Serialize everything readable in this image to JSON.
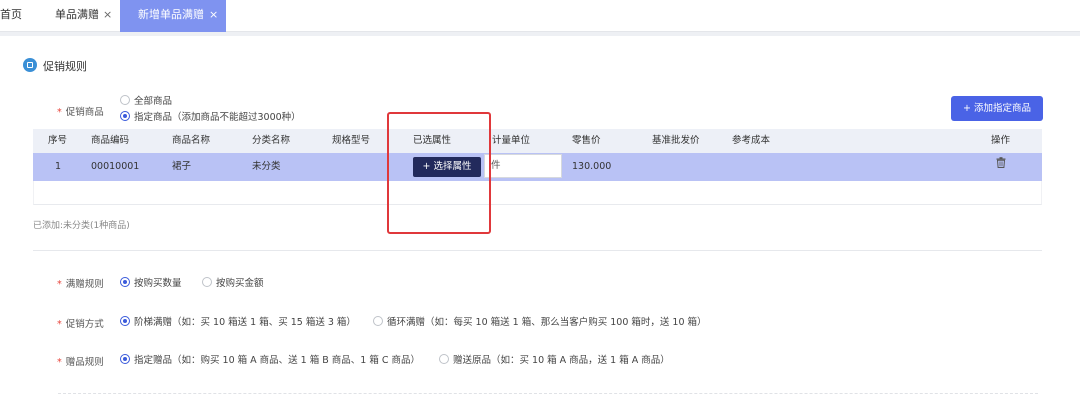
{
  "tabs": {
    "home": "首页",
    "tab1": "单品满赠",
    "tab2": "新增单品满赠",
    "close": "×"
  },
  "section": {
    "title": "促销规则"
  },
  "promo_goods": {
    "label": "促销商品",
    "required": "*",
    "options": [
      "全部商品",
      "指定商品（添加商品不能超过3000种）"
    ],
    "selected_index": 1
  },
  "add_button": "+ 添加指定商品",
  "table": {
    "headers": [
      "序号",
      "商品编码",
      "商品名称",
      "分类名称",
      "规格型号",
      "已选属性",
      "计量单位",
      "零售价",
      "基准批发价",
      "参考成本",
      "操作"
    ],
    "row": {
      "index": "1",
      "code": "00010001",
      "name": "裙子",
      "category": "未分类",
      "spec": "",
      "attr_button": "+ 选择属性",
      "unit": "件",
      "retail": "130.000",
      "wholesale": "",
      "cost": ""
    },
    "delete_icon": "trash-icon"
  },
  "added_summary": "已添加:未分类(1种商品)",
  "rules": [
    {
      "label": "满赠规则",
      "options": [
        "按购买数量",
        "按购买金额"
      ],
      "selected_index": 0
    },
    {
      "label": "促销方式",
      "options": [
        "阶梯满赠（如：买 10 箱送 1 箱、买 15 箱送 3 箱）",
        "循环满赠（如：每买 10 箱送 1 箱、那么当客户购买 100 箱时，送 10 箱）"
      ],
      "selected_index": 0
    },
    {
      "label": "赠品规则",
      "options": [
        "指定赠品（如：购买 10 箱 A 商品、送 1 箱 B 商品、1 箱 C 商品）",
        "赠送原品（如：买 10 箱 A 商品，送 1 箱 A 商品）"
      ],
      "selected_index": 0
    }
  ],
  "colors": {
    "accent": "#4a63e6",
    "active_tab": "#7f93f0",
    "selected_row": "#b9c2f5",
    "highlight_box": "#e0383b"
  }
}
